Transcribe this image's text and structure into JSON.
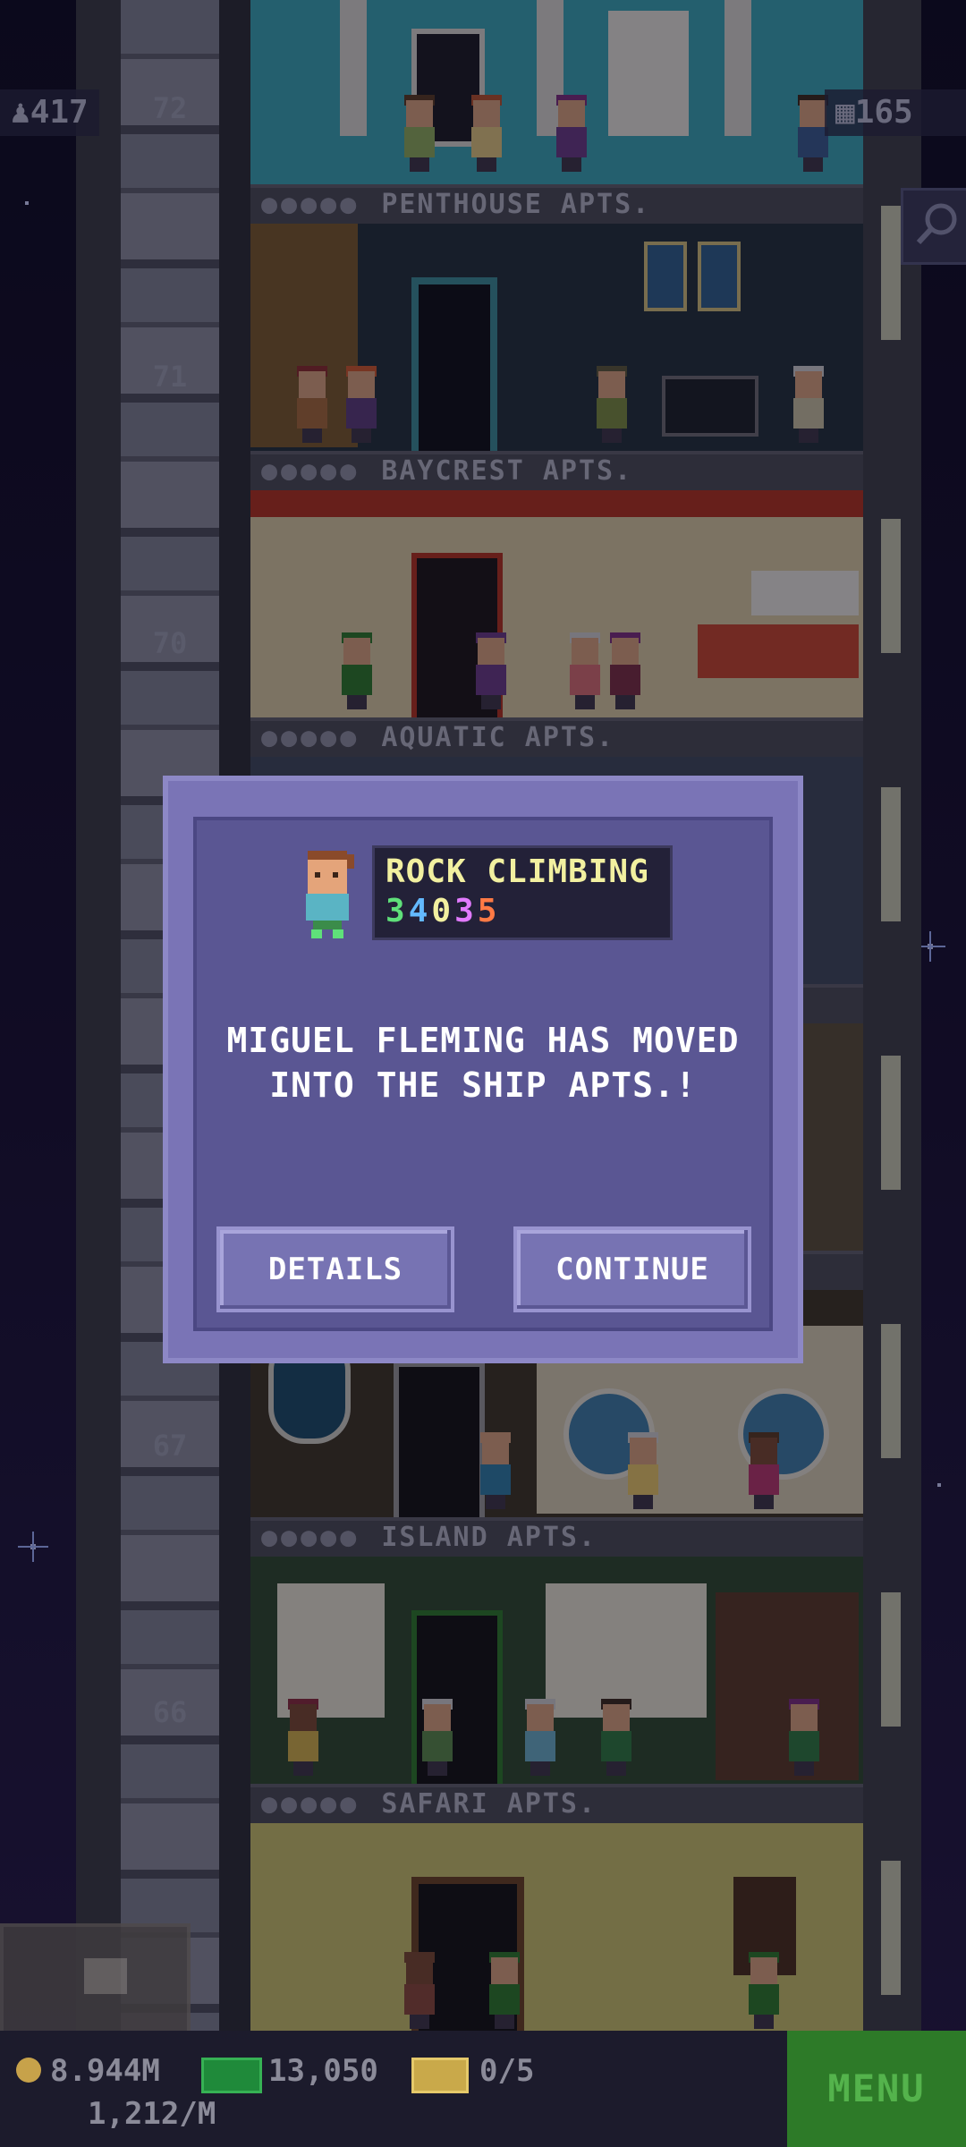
{
  "hud": {
    "population": "417",
    "floors": "165"
  },
  "floors": [
    {
      "number": "72",
      "name": "PENTHOUSE APTS."
    },
    {
      "number": "71",
      "name": "BAYCREST APTS."
    },
    {
      "number": "70",
      "name": "AQUATIC APTS."
    },
    {
      "number": "67",
      "name": "ISLAND APTS."
    },
    {
      "number": "66",
      "name": "SAFARI APTS."
    }
  ],
  "dialog": {
    "hobby": "ROCK CLIMBING",
    "hobby_digits": [
      "3",
      "4",
      "0",
      "3",
      "5"
    ],
    "hobby_digit_colors": [
      "#5fe07a",
      "#63b9ff",
      "#f2f0a0",
      "#e27bff",
      "#ff7a45"
    ],
    "message_line1": "MIGUEL FLEMING HAS MOVED",
    "message_line2": "INTO THE SHIP APTS.!",
    "details_label": "DETAILS",
    "continue_label": "CONTINUE"
  },
  "bottom": {
    "coins": "8.944M",
    "coin_rate": "1,212/M",
    "bux": "13,050",
    "tickets": "0/5",
    "menu_label": "MENU"
  },
  "colors": {
    "dialog_bg": "#5a5693",
    "button_bg": "#7773b3",
    "menu_green": "#2d7a28"
  }
}
